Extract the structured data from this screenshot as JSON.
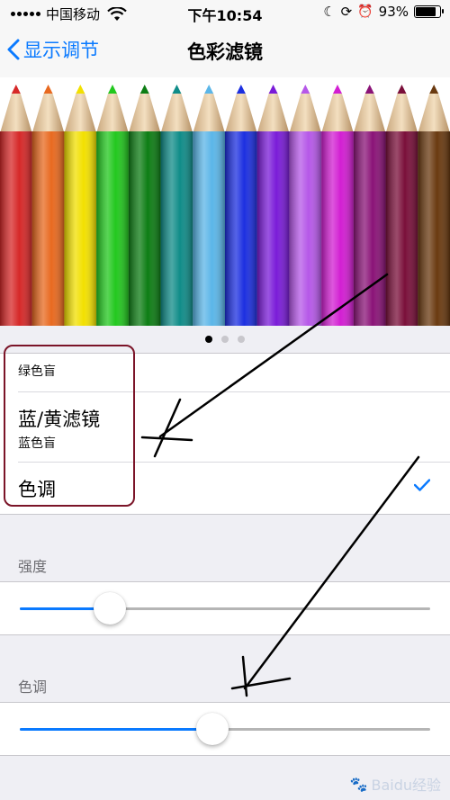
{
  "status_bar": {
    "carrier": "中国移动",
    "time": "下午10:54",
    "battery_text": "93%",
    "battery_level": 0.93
  },
  "nav": {
    "back_label": "显示调节",
    "title": "色彩滤镜"
  },
  "preview": {
    "pencil_colors": [
      "#d62828",
      "#e8691f",
      "#f2e000",
      "#22c81e",
      "#0d7d14",
      "#0f8c88",
      "#5bb6e8",
      "#1c2fe0",
      "#7a1bd8",
      "#b658e8",
      "#d21ed2",
      "#8a1377",
      "#7a0f3a",
      "#6a3a10"
    ],
    "page_count": 3,
    "current_page": 1
  },
  "filter_options": [
    {
      "title": "",
      "subtitle": "绿色盲",
      "selected": false
    },
    {
      "title": "蓝/黄滤镜",
      "subtitle": "蓝色盲",
      "selected": false
    },
    {
      "title": "色调",
      "subtitle": "",
      "selected": true
    }
  ],
  "intensity": {
    "label": "强度",
    "value": 0.22
  },
  "hue": {
    "label": "色调",
    "value": 0.47
  },
  "colors": {
    "accent": "#0a7aff",
    "highlight_border": "#7b1428"
  },
  "watermark": "Baidu经验"
}
